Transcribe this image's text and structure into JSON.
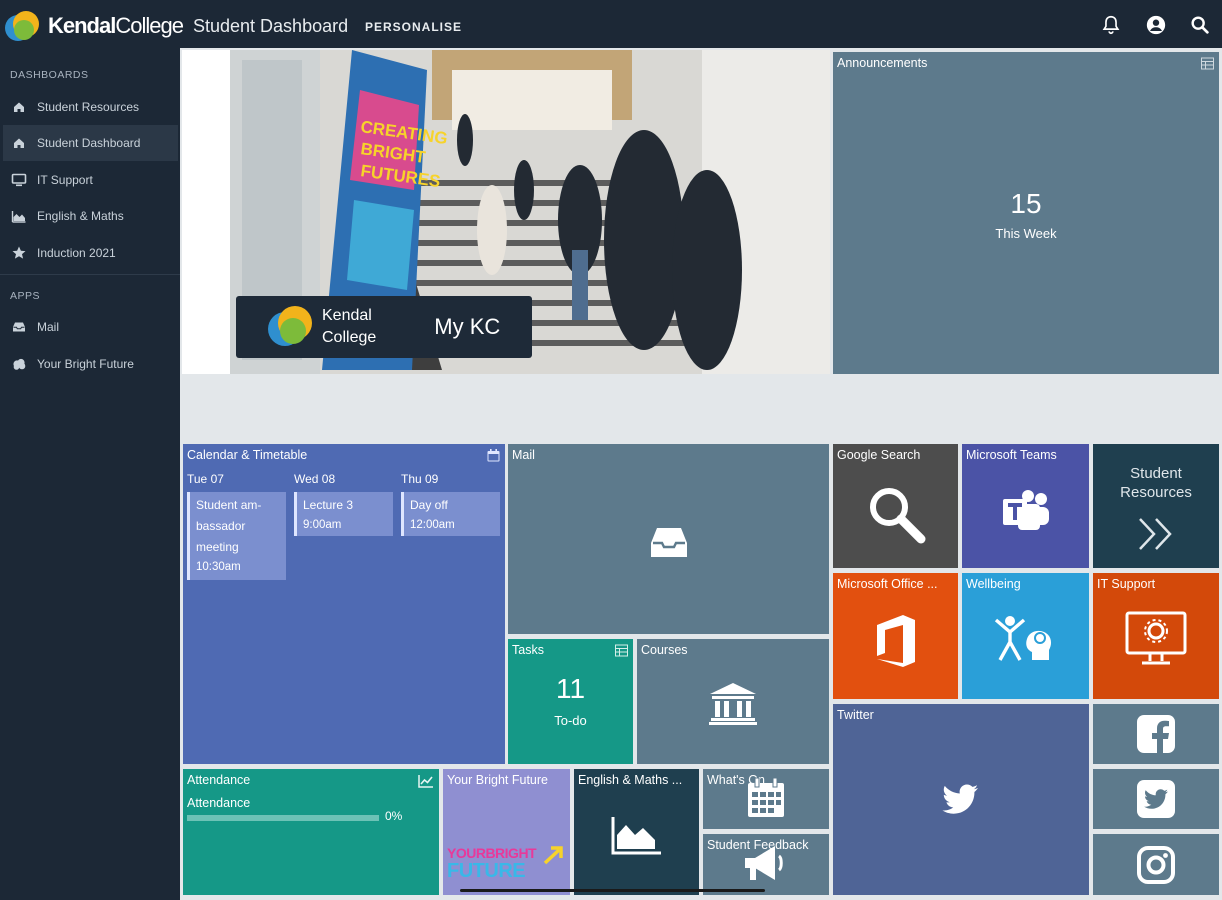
{
  "header": {
    "logo_text_bold": "Kendal",
    "logo_text_thin": "College",
    "page_title": "Student Dashboard",
    "personalise": "PERSONALISE",
    "icons": [
      "bell-icon",
      "user-icon",
      "search-icon"
    ]
  },
  "sidebar": {
    "dashboards_header": "DASHBOARDS",
    "apps_header": "APPS",
    "dashboards": [
      {
        "label": "Student Resources",
        "icon": "home-icon"
      },
      {
        "label": "Student Dashboard",
        "icon": "home-icon",
        "active": true
      },
      {
        "label": "IT Support",
        "icon": "monitor-icon"
      },
      {
        "label": "English & Maths",
        "icon": "chart-icon"
      },
      {
        "label": "Induction 2021",
        "icon": "star-icon"
      }
    ],
    "apps": [
      {
        "label": "Mail",
        "icon": "inbox-icon"
      },
      {
        "label": "Your Bright Future",
        "icon": "cloud-icon"
      }
    ]
  },
  "hero": {
    "poster_lines": [
      "CREATING",
      "BRIGHT",
      "FUTURES"
    ],
    "badge_college_line1": "Kendal",
    "badge_college_line2": "College",
    "badge_title": "My KC"
  },
  "tiles": {
    "announcements": {
      "title": "Announcements",
      "count": "15",
      "label": "This Week"
    },
    "calendar": {
      "title": "Calendar & Timetable",
      "days": [
        {
          "label": "Tue 07",
          "events": [
            {
              "name_lines": [
                "Student am-",
                "bassador",
                "meeting"
              ],
              "time": "10:30am"
            }
          ]
        },
        {
          "label": "Wed 08",
          "events": [
            {
              "name_lines": [
                "Lecture 3"
              ],
              "time": "9:00am"
            }
          ]
        },
        {
          "label": "Thu 09",
          "events": [
            {
              "name_lines": [
                "Day off"
              ],
              "time": "12:00am"
            }
          ]
        }
      ]
    },
    "mail": {
      "title": "Mail"
    },
    "google_search": {
      "title": "Google Search"
    },
    "microsoft_teams": {
      "title": "Microsoft Teams"
    },
    "student_resources": {
      "title_line1": "Student",
      "title_line2": "Resources"
    },
    "microsoft_office": {
      "title": "Microsoft Office ..."
    },
    "wellbeing": {
      "title": "Wellbeing"
    },
    "it_support": {
      "title": "IT Support"
    },
    "tasks": {
      "title": "Tasks",
      "count": "11",
      "label": "To-do"
    },
    "courses": {
      "title": "Courses"
    },
    "twitter": {
      "title": "Twitter"
    },
    "attendance": {
      "title": "Attendance",
      "label": "Attendance",
      "percent_text": "0%",
      "percent": 0
    },
    "your_bright_future": {
      "title": "Your Bright Future",
      "logo_line1": "YOURBRIGHT",
      "logo_line2": "FUTURE"
    },
    "english_maths": {
      "title": "English & Maths ..."
    },
    "whats_on": {
      "title": "What's On"
    },
    "student_feedback": {
      "title": "Student Feedback"
    }
  },
  "colors": {
    "sidebar_bg": "#1c2836",
    "slate_tile": "#5d7a8c",
    "calendar_blue": "#4f6ab3",
    "teal": "#159887",
    "office_orange": "#e2500f",
    "wellbeing_blue": "#2a9fd8",
    "it_orange": "#d3490a",
    "teams_purple": "#4b53a6",
    "twitter_blue": "#4f6496"
  }
}
